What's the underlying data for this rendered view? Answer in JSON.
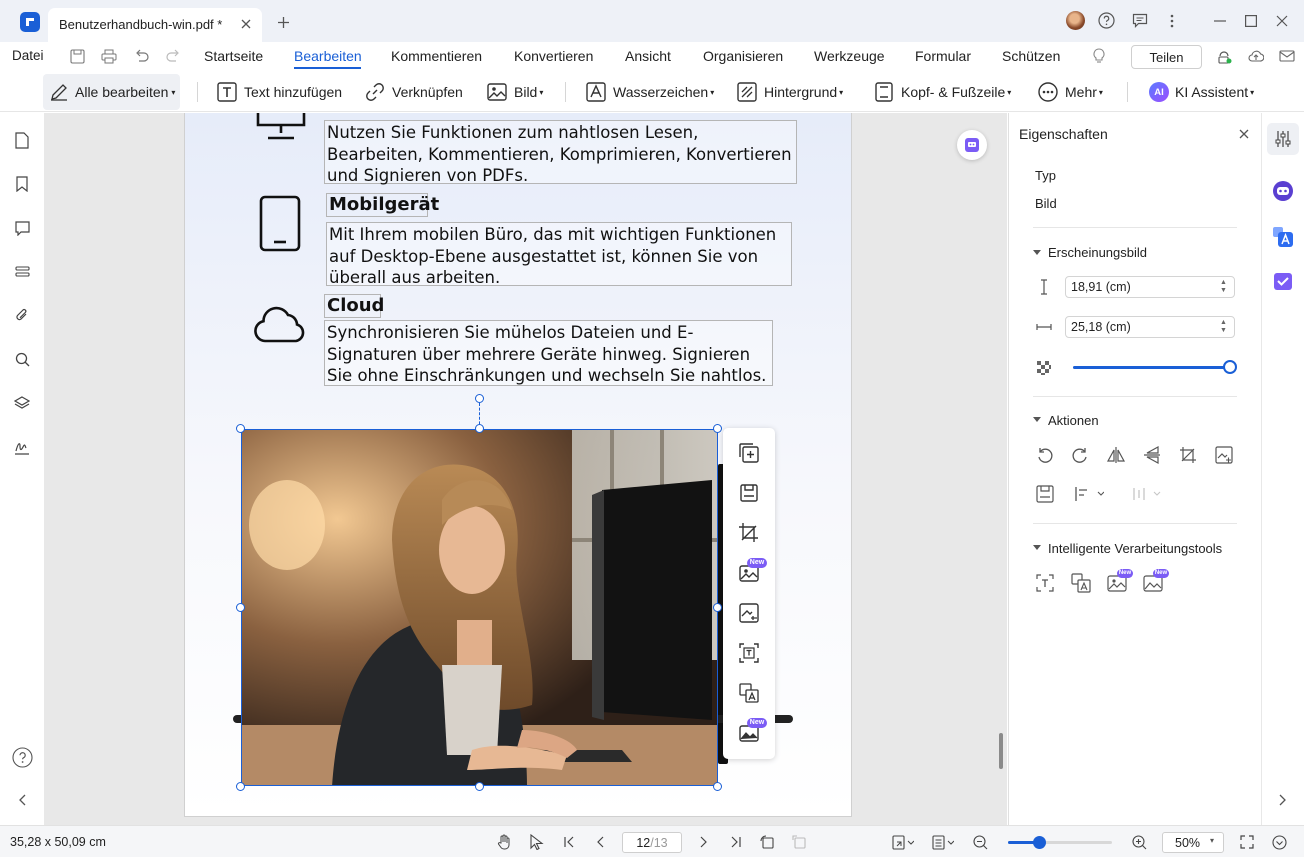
{
  "app": {
    "brand_color": "#1a5fd6",
    "accent_purple": "#7b5cf5"
  },
  "titlebar": {
    "tab_title": "Benutzerhandbuch-win.pdf *",
    "close_icon": "close-icon",
    "new_tab_icon": "plus-icon"
  },
  "menubar": {
    "file_label": "Datei",
    "items": [
      "Startseite",
      "Bearbeiten",
      "Kommentieren",
      "Konvertieren",
      "Ansicht",
      "Organisieren",
      "Werkzeuge",
      "Formular",
      "Schützen"
    ],
    "active_item": "Bearbeiten",
    "share_label": "Teilen"
  },
  "toolbar": {
    "edit_all": "Alle bearbeiten",
    "add_text": "Text hinzufügen",
    "link": "Verknüpfen",
    "image": "Bild",
    "watermark": "Wasserzeichen",
    "background": "Hintergrund",
    "header_footer": "Kopf- & Fußzeile",
    "more": "Mehr",
    "ai_badge": "AI",
    "ai_assistant": "KI Assistent"
  },
  "document": {
    "block1_text": "Nutzen Sie Funktionen zum nahtlosen Lesen, Bearbeiten, Kommentieren, Komprimieren, Konvertieren und Signieren von PDFs.",
    "block2_heading": "Mobilgerät",
    "block2_text": "Mit Ihrem mobilen Büro, das mit wichtigen Funktionen auf Desktop-Ebene ausgestattet ist, können Sie von überall aus arbeiten.",
    "block3_heading": "Cloud",
    "block3_text": "Synchronisieren Sie mühelos Dateien und E-Signaturen über mehrere Geräte hinweg. Signieren Sie ohne Einschränkungen und wechseln Sie nahtlos."
  },
  "floatbar": {
    "new_badge": "New"
  },
  "panel": {
    "title": "Eigenschaften",
    "type_label": "Typ",
    "type_value": "Bild",
    "appearance_label": "Erscheinungsbild",
    "height_value": "18,91 (cm)",
    "width_value": "25,18 (cm)",
    "opacity_percent": 100,
    "actions_label": "Aktionen",
    "smart_tools_label": "Intelligente Verarbeitungstools",
    "new_badge": "New"
  },
  "status": {
    "dimensions": "35,28 x 50,09 cm",
    "current_page": "12",
    "total_pages": "/13",
    "zoom": "50%",
    "zoom_slider_percent": 30
  }
}
